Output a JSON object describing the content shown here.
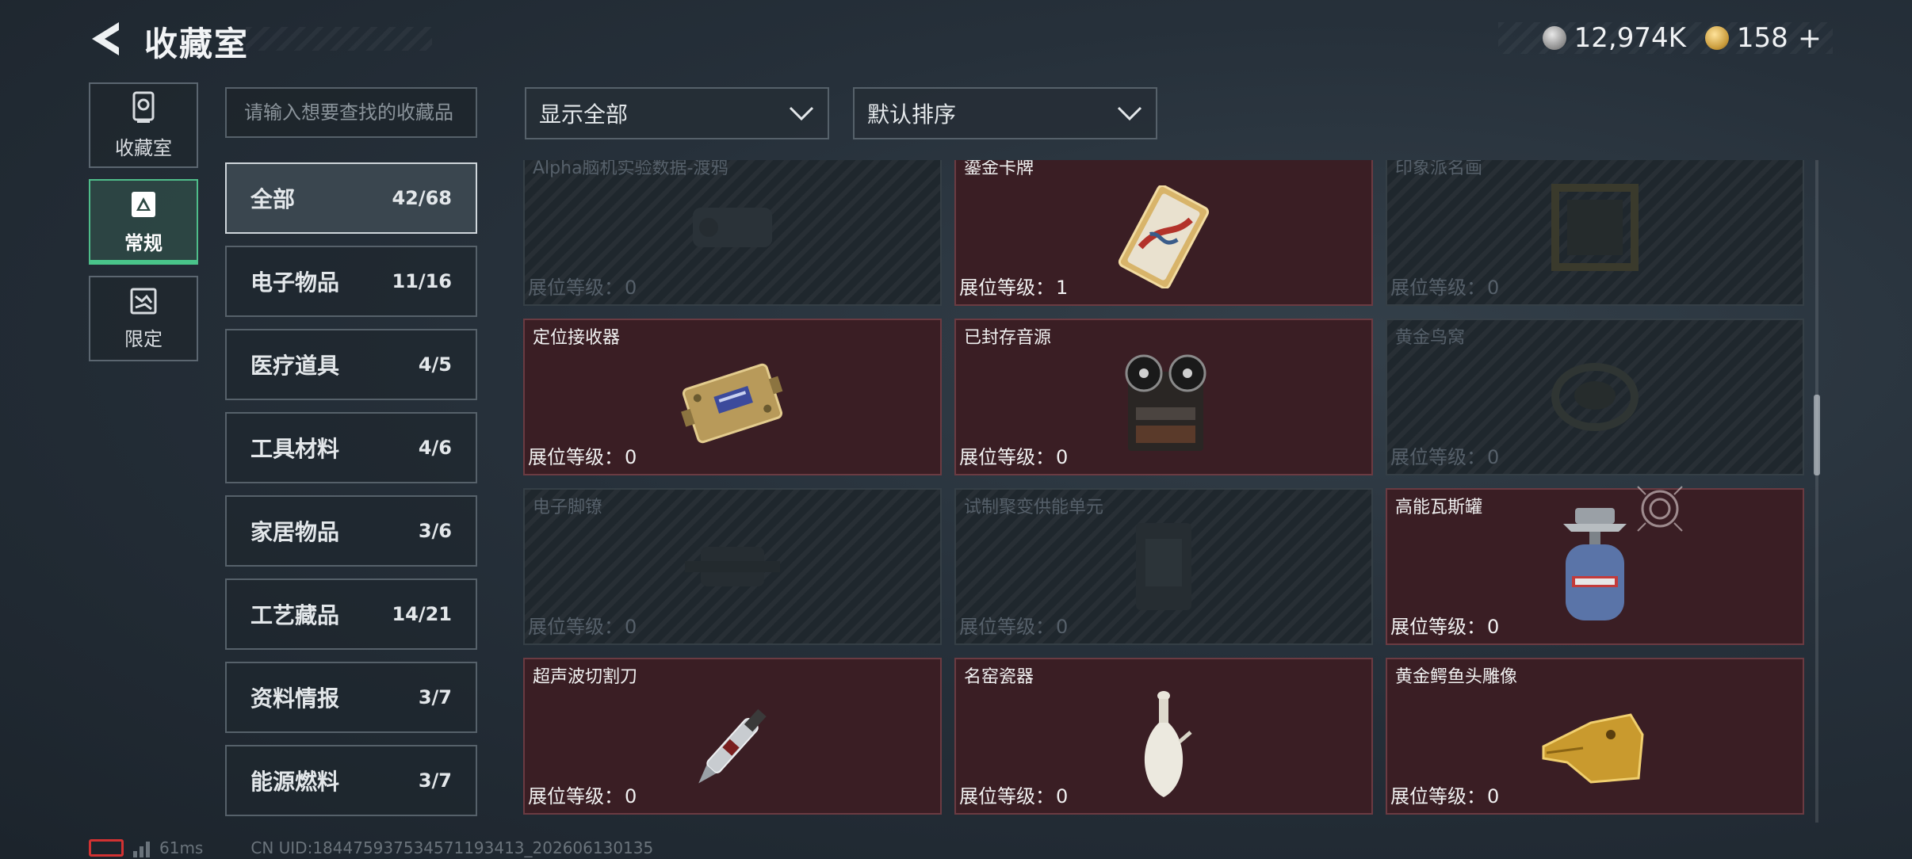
{
  "header": {
    "title": "收藏室",
    "currency_silver": "12,974K",
    "currency_gold": "158",
    "plus_label": "+"
  },
  "side_tabs": [
    {
      "label": "收藏室",
      "icon": "trophy-icon",
      "active": false
    },
    {
      "label": "常规",
      "icon": "card-icon",
      "active": true
    },
    {
      "label": "限定",
      "icon": "map-icon",
      "active": false
    }
  ],
  "search": {
    "placeholder": "请输入想要查找的收藏品",
    "value": ""
  },
  "categories": [
    {
      "name": "全部",
      "count": "42/68",
      "active": true
    },
    {
      "name": "电子物品",
      "count": "11/16"
    },
    {
      "name": "医疗道具",
      "count": "4/5"
    },
    {
      "name": "工具材料",
      "count": "4/6"
    },
    {
      "name": "家居物品",
      "count": "3/6"
    },
    {
      "name": "工艺藏品",
      "count": "14/21"
    },
    {
      "name": "资料情报",
      "count": "3/7"
    },
    {
      "name": "能源燃料",
      "count": "3/7"
    }
  ],
  "filters": {
    "display": "显示全部",
    "sort": "默认排序"
  },
  "level_label": "展位等级：",
  "items": [
    {
      "name": "Alpha脑机实验数据-渡鸦",
      "level": "0",
      "unlocked": false,
      "icon": "brain-data-icon"
    },
    {
      "name": "鎏金卡牌",
      "level": "1",
      "unlocked": true,
      "icon": "gilded-card-icon"
    },
    {
      "name": "印象派名画",
      "level": "0",
      "unlocked": false,
      "icon": "painting-icon"
    },
    {
      "name": "定位接收器",
      "level": "0",
      "unlocked": true,
      "icon": "gps-receiver-icon"
    },
    {
      "name": "已封存音源",
      "level": "0",
      "unlocked": true,
      "icon": "reel-recorder-icon"
    },
    {
      "name": "黄金鸟窝",
      "level": "0",
      "unlocked": false,
      "icon": "bird-nest-icon"
    },
    {
      "name": "电子脚镣",
      "level": "0",
      "unlocked": false,
      "icon": "ankle-monitor-icon"
    },
    {
      "name": "试制聚变供能单元",
      "level": "0",
      "unlocked": false,
      "icon": "fusion-cell-icon"
    },
    {
      "name": "高能瓦斯罐",
      "level": "0",
      "unlocked": true,
      "icon": "gas-canister-icon"
    },
    {
      "name": "超声波切割刀",
      "level": "0",
      "unlocked": true,
      "icon": "ultrasonic-knife-icon"
    },
    {
      "name": "名窑瓷器",
      "level": "0",
      "unlocked": true,
      "icon": "porcelain-vase-icon"
    },
    {
      "name": "黄金鳄鱼头雕像",
      "level": "0",
      "unlocked": true,
      "icon": "gold-crocodile-icon"
    }
  ],
  "footer": {
    "ping": "61ms",
    "uid": "CN UID:184475937534571193413_202606130135"
  },
  "colors": {
    "accent_green": "#49c48a",
    "unlocked_card": "#3a1e24",
    "locked_card": "#1f272d"
  }
}
